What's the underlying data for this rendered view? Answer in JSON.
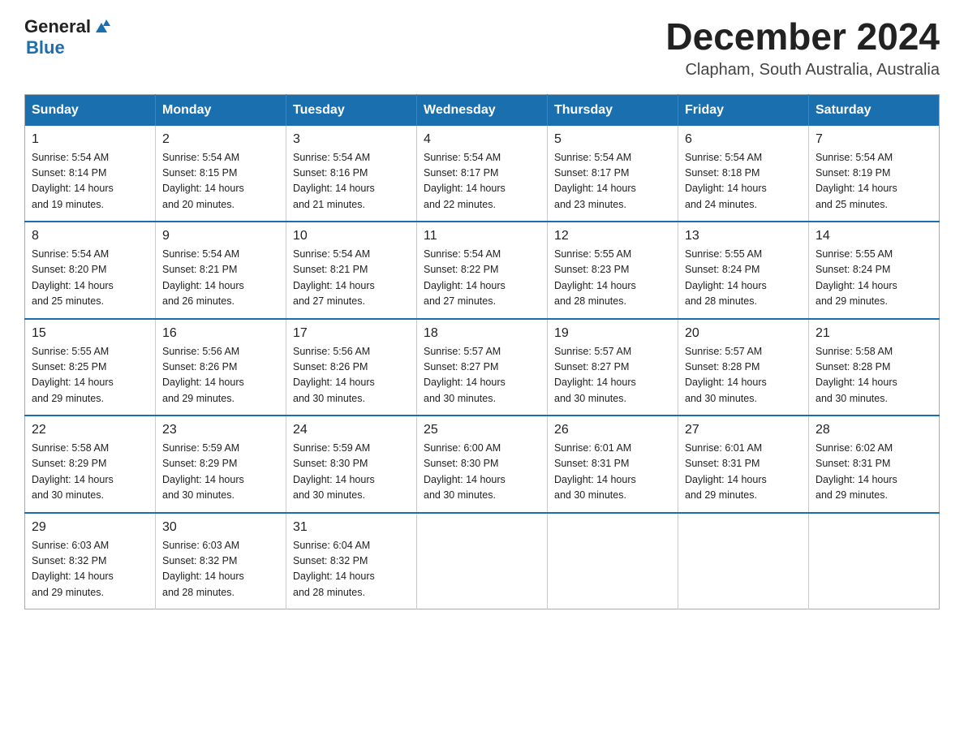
{
  "header": {
    "logo_general": "General",
    "logo_blue": "Blue",
    "month_year": "December 2024",
    "location": "Clapham, South Australia, Australia"
  },
  "days_of_week": [
    "Sunday",
    "Monday",
    "Tuesday",
    "Wednesday",
    "Thursday",
    "Friday",
    "Saturday"
  ],
  "weeks": [
    [
      {
        "day": "1",
        "sunrise": "5:54 AM",
        "sunset": "8:14 PM",
        "daylight": "14 hours and 19 minutes."
      },
      {
        "day": "2",
        "sunrise": "5:54 AM",
        "sunset": "8:15 PM",
        "daylight": "14 hours and 20 minutes."
      },
      {
        "day": "3",
        "sunrise": "5:54 AM",
        "sunset": "8:16 PM",
        "daylight": "14 hours and 21 minutes."
      },
      {
        "day": "4",
        "sunrise": "5:54 AM",
        "sunset": "8:17 PM",
        "daylight": "14 hours and 22 minutes."
      },
      {
        "day": "5",
        "sunrise": "5:54 AM",
        "sunset": "8:17 PM",
        "daylight": "14 hours and 23 minutes."
      },
      {
        "day": "6",
        "sunrise": "5:54 AM",
        "sunset": "8:18 PM",
        "daylight": "14 hours and 24 minutes."
      },
      {
        "day": "7",
        "sunrise": "5:54 AM",
        "sunset": "8:19 PM",
        "daylight": "14 hours and 25 minutes."
      }
    ],
    [
      {
        "day": "8",
        "sunrise": "5:54 AM",
        "sunset": "8:20 PM",
        "daylight": "14 hours and 25 minutes."
      },
      {
        "day": "9",
        "sunrise": "5:54 AM",
        "sunset": "8:21 PM",
        "daylight": "14 hours and 26 minutes."
      },
      {
        "day": "10",
        "sunrise": "5:54 AM",
        "sunset": "8:21 PM",
        "daylight": "14 hours and 27 minutes."
      },
      {
        "day": "11",
        "sunrise": "5:54 AM",
        "sunset": "8:22 PM",
        "daylight": "14 hours and 27 minutes."
      },
      {
        "day": "12",
        "sunrise": "5:55 AM",
        "sunset": "8:23 PM",
        "daylight": "14 hours and 28 minutes."
      },
      {
        "day": "13",
        "sunrise": "5:55 AM",
        "sunset": "8:24 PM",
        "daylight": "14 hours and 28 minutes."
      },
      {
        "day": "14",
        "sunrise": "5:55 AM",
        "sunset": "8:24 PM",
        "daylight": "14 hours and 29 minutes."
      }
    ],
    [
      {
        "day": "15",
        "sunrise": "5:55 AM",
        "sunset": "8:25 PM",
        "daylight": "14 hours and 29 minutes."
      },
      {
        "day": "16",
        "sunrise": "5:56 AM",
        "sunset": "8:26 PM",
        "daylight": "14 hours and 29 minutes."
      },
      {
        "day": "17",
        "sunrise": "5:56 AM",
        "sunset": "8:26 PM",
        "daylight": "14 hours and 30 minutes."
      },
      {
        "day": "18",
        "sunrise": "5:57 AM",
        "sunset": "8:27 PM",
        "daylight": "14 hours and 30 minutes."
      },
      {
        "day": "19",
        "sunrise": "5:57 AM",
        "sunset": "8:27 PM",
        "daylight": "14 hours and 30 minutes."
      },
      {
        "day": "20",
        "sunrise": "5:57 AM",
        "sunset": "8:28 PM",
        "daylight": "14 hours and 30 minutes."
      },
      {
        "day": "21",
        "sunrise": "5:58 AM",
        "sunset": "8:28 PM",
        "daylight": "14 hours and 30 minutes."
      }
    ],
    [
      {
        "day": "22",
        "sunrise": "5:58 AM",
        "sunset": "8:29 PM",
        "daylight": "14 hours and 30 minutes."
      },
      {
        "day": "23",
        "sunrise": "5:59 AM",
        "sunset": "8:29 PM",
        "daylight": "14 hours and 30 minutes."
      },
      {
        "day": "24",
        "sunrise": "5:59 AM",
        "sunset": "8:30 PM",
        "daylight": "14 hours and 30 minutes."
      },
      {
        "day": "25",
        "sunrise": "6:00 AM",
        "sunset": "8:30 PM",
        "daylight": "14 hours and 30 minutes."
      },
      {
        "day": "26",
        "sunrise": "6:01 AM",
        "sunset": "8:31 PM",
        "daylight": "14 hours and 30 minutes."
      },
      {
        "day": "27",
        "sunrise": "6:01 AM",
        "sunset": "8:31 PM",
        "daylight": "14 hours and 29 minutes."
      },
      {
        "day": "28",
        "sunrise": "6:02 AM",
        "sunset": "8:31 PM",
        "daylight": "14 hours and 29 minutes."
      }
    ],
    [
      {
        "day": "29",
        "sunrise": "6:03 AM",
        "sunset": "8:32 PM",
        "daylight": "14 hours and 29 minutes."
      },
      {
        "day": "30",
        "sunrise": "6:03 AM",
        "sunset": "8:32 PM",
        "daylight": "14 hours and 28 minutes."
      },
      {
        "day": "31",
        "sunrise": "6:04 AM",
        "sunset": "8:32 PM",
        "daylight": "14 hours and 28 minutes."
      },
      null,
      null,
      null,
      null
    ]
  ]
}
